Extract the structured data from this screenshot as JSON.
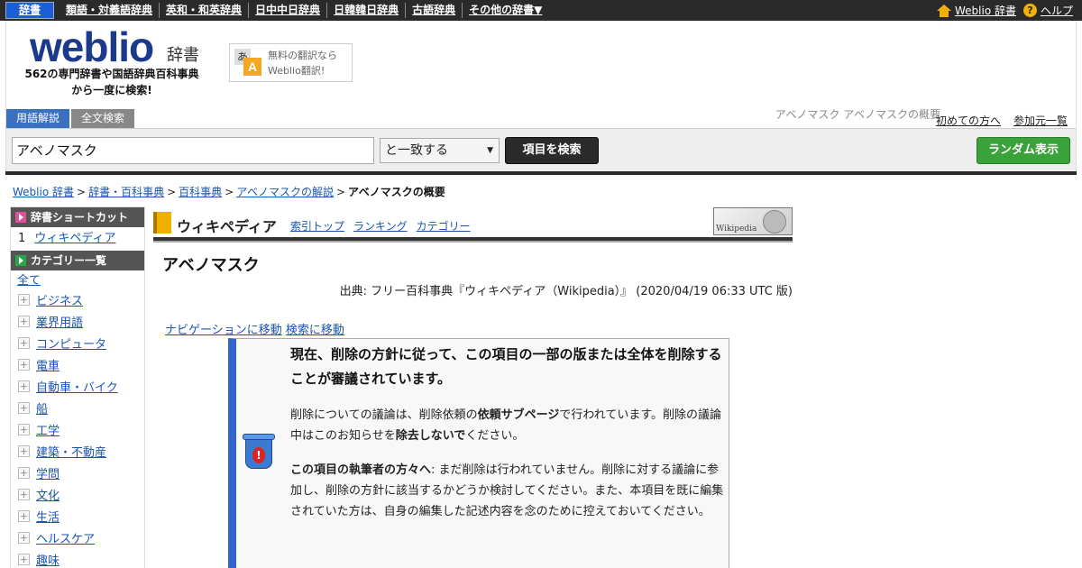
{
  "topnav": {
    "items": [
      "辞書",
      "類語・対義語辞典",
      "英和・和英辞典",
      "日中中日辞典",
      "日韓韓日辞典",
      "古語辞典",
      "その他の辞書▼"
    ],
    "home_link": "Weblio 辞書",
    "help_link": "ヘルプ"
  },
  "header": {
    "logo": "weblio",
    "logo_sub": "辞書",
    "tagline_line1": "562の専門辞書や国語辞典百科事典",
    "tagline_line2": "から一度に検索!",
    "promo_line1": "無料の翻訳なら",
    "promo_line2": "Weblio翻訳!",
    "promo_icon_a1": "あ",
    "promo_icon_a2": "A",
    "tabs": [
      "用語解説",
      "全文検索"
    ],
    "right_note": "アベノマスク アベノマスクの概要",
    "links": [
      "初めての方へ",
      "参加元一覧"
    ]
  },
  "search": {
    "value": "アベノマスク",
    "match_mode": "と一致する",
    "search_button": "項目を検索",
    "random_button": "ランダム表示"
  },
  "breadcrumb": {
    "items": [
      "Weblio 辞書",
      "辞書・百科事典",
      "百科事典",
      "アベノマスクの解説"
    ],
    "current": "アベノマスクの概要",
    "separator": ">"
  },
  "sidebar": {
    "shortcut_title": "辞書ショートカット",
    "shortcut_num": "1",
    "shortcut_item": "ウィキペディア",
    "category_title": "カテゴリー一覧",
    "all_label": "全て",
    "categories": [
      "ビジネス",
      "業界用語",
      "コンピュータ",
      "電車",
      "自動車・バイク",
      "船",
      "工学",
      "建築・不動産",
      "学問",
      "文化",
      "生活",
      "ヘルスケア",
      "趣味"
    ]
  },
  "wiki": {
    "title": "ウィキペディア",
    "links": [
      "索引トップ",
      "ランキング",
      "カテゴリー"
    ],
    "logo_text": "Wikipedia"
  },
  "article": {
    "title": "アベノマスク",
    "source": "出典: フリー百科事典『ウィキペディア（Wikipedia）』 (2020/04/19 06:33 UTC 版)",
    "skip_nav": "ナビゲーションに移動",
    "skip_search": "検索に移動"
  },
  "notice": {
    "heading": "現在、削除の方針に従って、この項目の一部の版または全体を削除することが審議されています。",
    "p1_a": "削除についての議論は、削除依頼の",
    "p1_b": "依頼サブページ",
    "p1_c": "で行われています。削除の議論中はこのお知らせを",
    "p1_d": "除去しないで",
    "p1_e": "ください。",
    "p2_a": "この項目の執筆者の方々へ",
    "p2_b": ": まだ削除は行われていません。削除に対する議論に参加し、削除の方針に該当するかどうか検討してください。また、本項目を既に編集されていた方は、自身の編集した記述内容を念のために控えておいてください。"
  },
  "colors": {
    "topbar": "#2a2a2a",
    "logo_blue": "#1b3a8c",
    "link": "#1a55b0",
    "random_green": "#3aa23a",
    "notice_bar": "#3366cc"
  }
}
